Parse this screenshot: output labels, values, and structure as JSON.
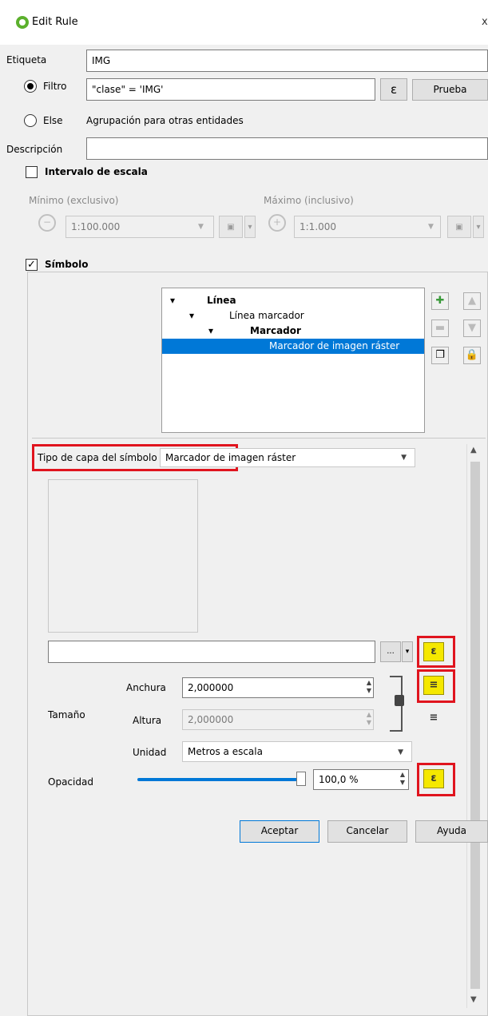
{
  "window": {
    "title": "Edit Rule",
    "close": "x"
  },
  "rule": {
    "etiqueta_label": "Etiqueta",
    "etiqueta_value": "IMG",
    "filtro_label": "Filtro",
    "filtro_value": "\"clase\"  =  'IMG'",
    "expr_symbol": "ε",
    "prueba_label": "Prueba",
    "else_label": "Else",
    "else_desc": "Agrupación para otras entidades",
    "descripcion_label": "Descripción",
    "descripcion_value": ""
  },
  "scale": {
    "section_label": "Intervalo de escala",
    "min_label": "Mínimo (exclusivo)",
    "max_label": "Máximo (inclusivo)",
    "min_value": "1:100.000",
    "max_value": "1:1.000"
  },
  "symbol": {
    "section_label": "Símbolo",
    "tree": [
      {
        "label": "Línea",
        "bold": true,
        "arrow": "▾"
      },
      {
        "label": "Línea marcador",
        "bold": false,
        "arrow": "▾"
      },
      {
        "label": "Marcador",
        "bold": true,
        "arrow": "▾"
      },
      {
        "label": "Marcador de imagen ráster",
        "bold": false,
        "arrow": "",
        "selected": true
      }
    ]
  },
  "layer": {
    "type_label": "Tipo de capa del símbolo",
    "type_value": "Marcador de imagen ráster",
    "path_value": "",
    "browse_label": "...",
    "size_label": "Tamaño",
    "width_label": "Anchura",
    "width_value": "2,000000",
    "height_label": "Altura",
    "height_value": "2,000000",
    "unit_label": "Unidad",
    "unit_value": "Metros a escala",
    "opacity_label": "Opacidad",
    "opacity_value": "100,0 %",
    "opacity_fraction": 1.0
  },
  "footer": {
    "accept_label": "Aceptar",
    "cancel_label": "Cancelar",
    "help_label": "Ayuda"
  },
  "colors": {
    "accent": "#0078d7",
    "highlight": "#e0141e",
    "logo": "#5bb02c"
  }
}
